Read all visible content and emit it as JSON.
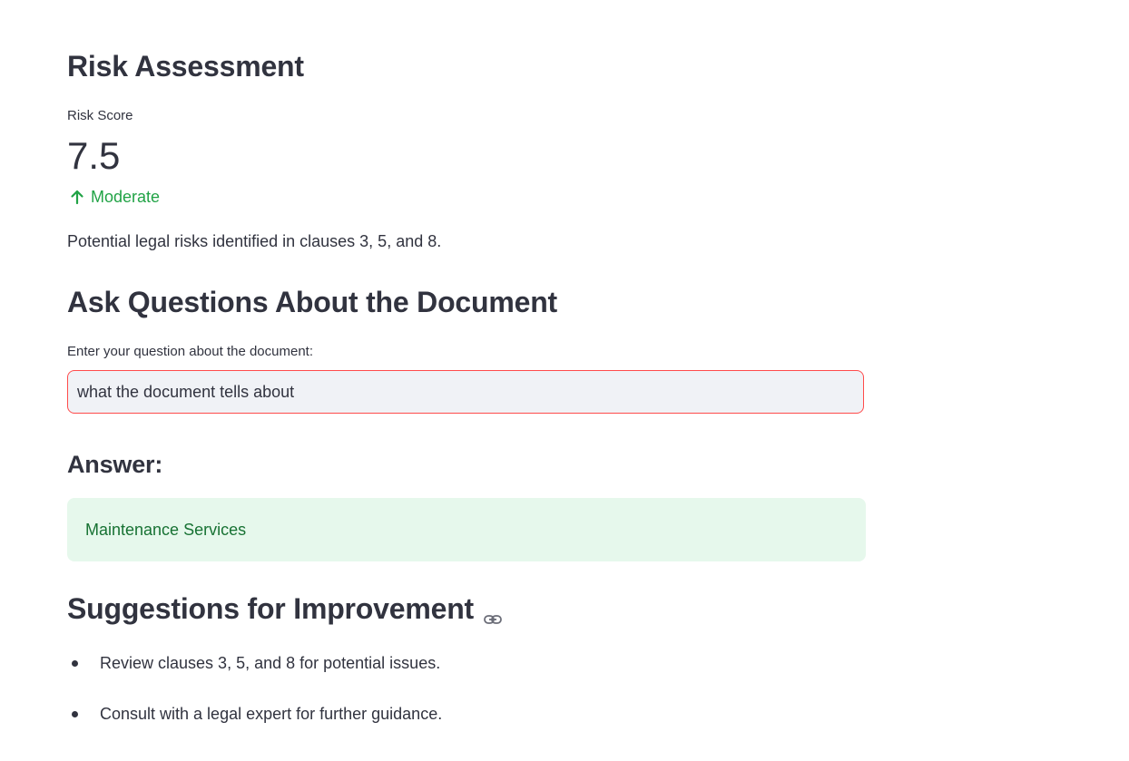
{
  "risk_section": {
    "heading": "Risk Assessment",
    "metric_label": "Risk Score",
    "metric_value": "7.5",
    "delta_label": "Moderate",
    "delta_icon": "arrow-up-icon",
    "description": "Potential legal risks identified in clauses 3, 5, and 8."
  },
  "qa_section": {
    "heading": "Ask Questions About the Document",
    "input_label": "Enter your question about the document:",
    "input_value": "what the document tells about"
  },
  "answer_section": {
    "heading": "Answer:",
    "answer_text": "Maintenance Services"
  },
  "suggestions_section": {
    "heading": "Suggestions for Improvement",
    "heading_icon": "link-icon",
    "items": [
      "Review clauses 3, 5, and 8 for potential issues.",
      "Consult with a legal expert for further guidance."
    ]
  },
  "colors": {
    "text": "#31333f",
    "delta_green": "#21a346",
    "input_border_focus": "#ff4b4b",
    "input_bg": "#f0f2f6",
    "success_bg": "#e6f8ec",
    "success_text": "#177233"
  }
}
